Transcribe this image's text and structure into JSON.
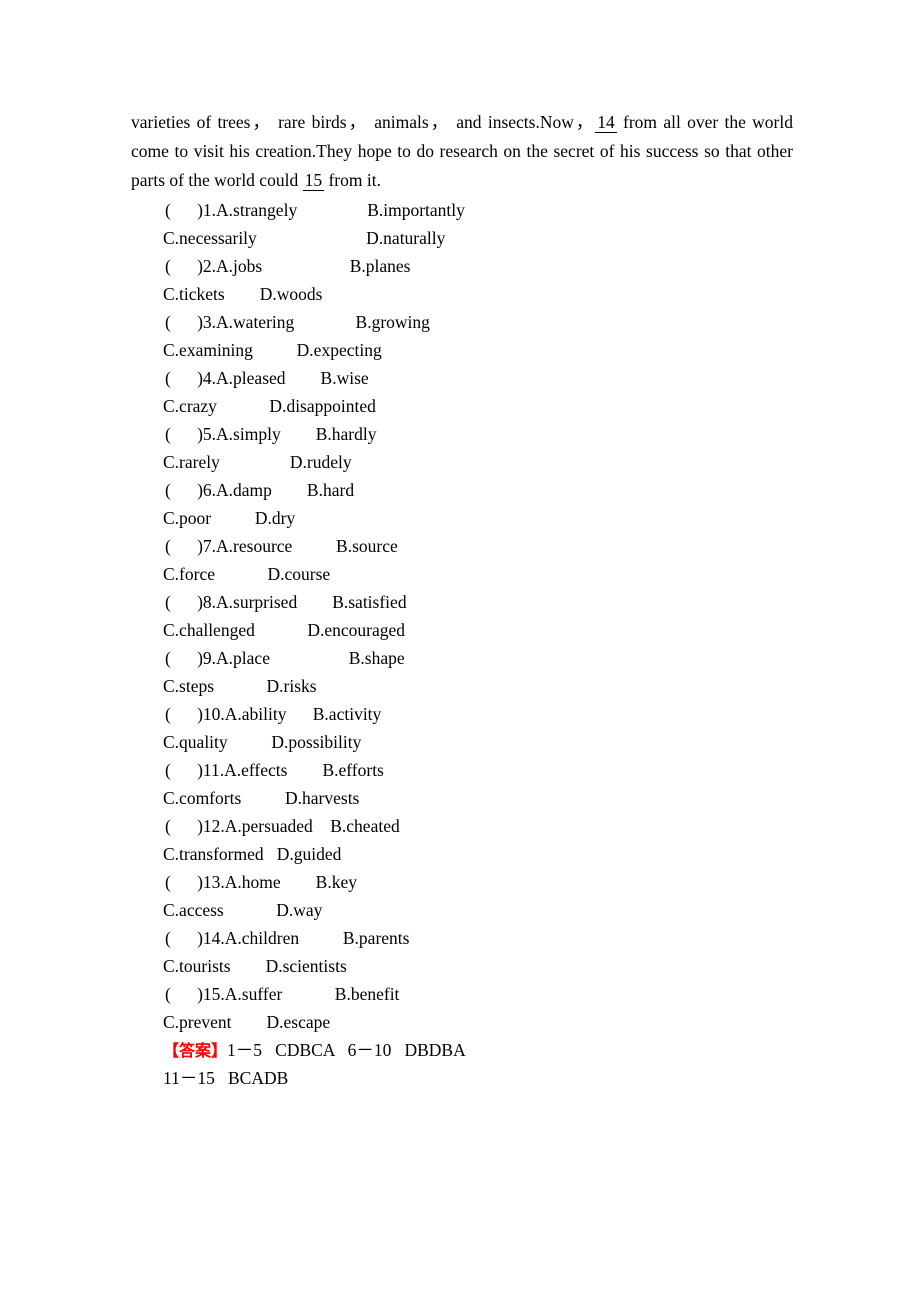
{
  "document": {
    "type": "cloze-test-worksheet",
    "page_background": "#ffffff",
    "text_color": "#000000",
    "accent_color": "#ff0000"
  },
  "passage": {
    "line1_pre": "varieties of trees，  rare birds，  animals，  and insects.Now，",
    "blank_14": "14",
    "line1_post": "from all over the world come",
    "line2": "to visit his creation.They hope to do research on the secret of his success so that other parts of the",
    "line3_pre": "world could",
    "blank_15": "15",
    "line3_post": "from it."
  },
  "questions": [
    {
      "number": "1",
      "marker": "(      )",
      "ab": "(      )1.A.strangely                B.importantly",
      "cd": "C.necessarily                         D.naturally",
      "a": "A.strangely",
      "b": "B.importantly",
      "c": "C.necessarily",
      "d": "D.naturally"
    },
    {
      "number": "2",
      "marker": "(      )",
      "ab": "(      )2.A.jobs                    B.planes",
      "cd": "C.tickets        D.woods",
      "a": "A.jobs",
      "b": "B.planes",
      "c": "C.tickets",
      "d": "D.woods"
    },
    {
      "number": "3",
      "marker": "(      )",
      "ab": "(      )3.A.watering              B.growing",
      "cd": "C.examining          D.expecting",
      "a": "A.watering",
      "b": "B.growing",
      "c": "C.examining",
      "d": "D.expecting"
    },
    {
      "number": "4",
      "marker": "(      )",
      "ab": "(      )4.A.pleased        B.wise",
      "cd": "C.crazy            D.disappointed",
      "a": "A.pleased",
      "b": "B.wise",
      "c": "C.crazy",
      "d": "D.disappointed"
    },
    {
      "number": "5",
      "marker": "(      )",
      "ab": "(      )5.A.simply        B.hardly",
      "cd": "C.rarely                D.rudely",
      "a": "A.simply",
      "b": "B.hardly",
      "c": "C.rarely",
      "d": "D.rudely"
    },
    {
      "number": "6",
      "marker": "(      )",
      "ab": "(      )6.A.damp        B.hard",
      "cd": "C.poor          D.dry",
      "a": "A.damp",
      "b": "B.hard",
      "c": "C.poor",
      "d": "D.dry"
    },
    {
      "number": "7",
      "marker": "(      )",
      "ab": "(      )7.A.resource          B.source",
      "cd": "C.force            D.course",
      "a": "A.resource",
      "b": "B.source",
      "c": "C.force",
      "d": "D.course"
    },
    {
      "number": "8",
      "marker": "(      )",
      "ab": "(      )8.A.surprised        B.satisfied",
      "cd": "C.challenged            D.encouraged",
      "a": "A.surprised",
      "b": "B.satisfied",
      "c": "C.challenged",
      "d": "D.encouraged"
    },
    {
      "number": "9",
      "marker": "(      )",
      "ab": "(      )9.A.place                  B.shape",
      "cd": "C.steps            D.risks",
      "a": "A.place",
      "b": "B.shape",
      "c": "C.steps",
      "d": "D.risks"
    },
    {
      "number": "10",
      "marker": "(      )",
      "ab": "(      )10.A.ability      B.activity",
      "cd": "C.quality          D.possibility",
      "a": "A.ability",
      "b": "B.activity",
      "c": "C.quality",
      "d": "D.possibility"
    },
    {
      "number": "11",
      "marker": "(      )",
      "ab": "(      )11.A.effects        B.efforts",
      "cd": "C.comforts          D.harvests",
      "a": "A.effects",
      "b": "B.efforts",
      "c": "C.comforts",
      "d": "D.harvests"
    },
    {
      "number": "12",
      "marker": "(      )",
      "ab": "(      )12.A.persuaded    B.cheated",
      "cd": "C.transformed   D.guided",
      "a": "A.persuaded",
      "b": "B.cheated",
      "c": "C.transformed",
      "d": "D.guided"
    },
    {
      "number": "13",
      "marker": "(      )",
      "ab": "(      )13.A.home        B.key",
      "cd": "C.access            D.way",
      "a": "A.home",
      "b": "B.key",
      "c": "C.access",
      "d": "D.way"
    },
    {
      "number": "14",
      "marker": "(      )",
      "ab": "(      )14.A.children          B.parents",
      "cd": "C.tourists        D.scientists",
      "a": "A.children",
      "b": "B.parents",
      "c": "C.tourists",
      "d": "D.scientists"
    },
    {
      "number": "15",
      "marker": "(      )",
      "ab": "(      )15.A.suffer            B.benefit",
      "cd": "C.prevent        D.escape",
      "a": "A.suffer",
      "b": "B.benefit",
      "c": "C.prevent",
      "d": "D.escape"
    }
  ],
  "answers": {
    "tag": "【答案】",
    "line1": "1－5   CDBCA   6－10   DBDBA",
    "line2": "11－15   BCADB",
    "ranges": [
      {
        "range": "1－5",
        "letters": "CDBCA"
      },
      {
        "range": "6－10",
        "letters": "DBDBA"
      },
      {
        "range": "11－15",
        "letters": "BCADB"
      }
    ]
  }
}
